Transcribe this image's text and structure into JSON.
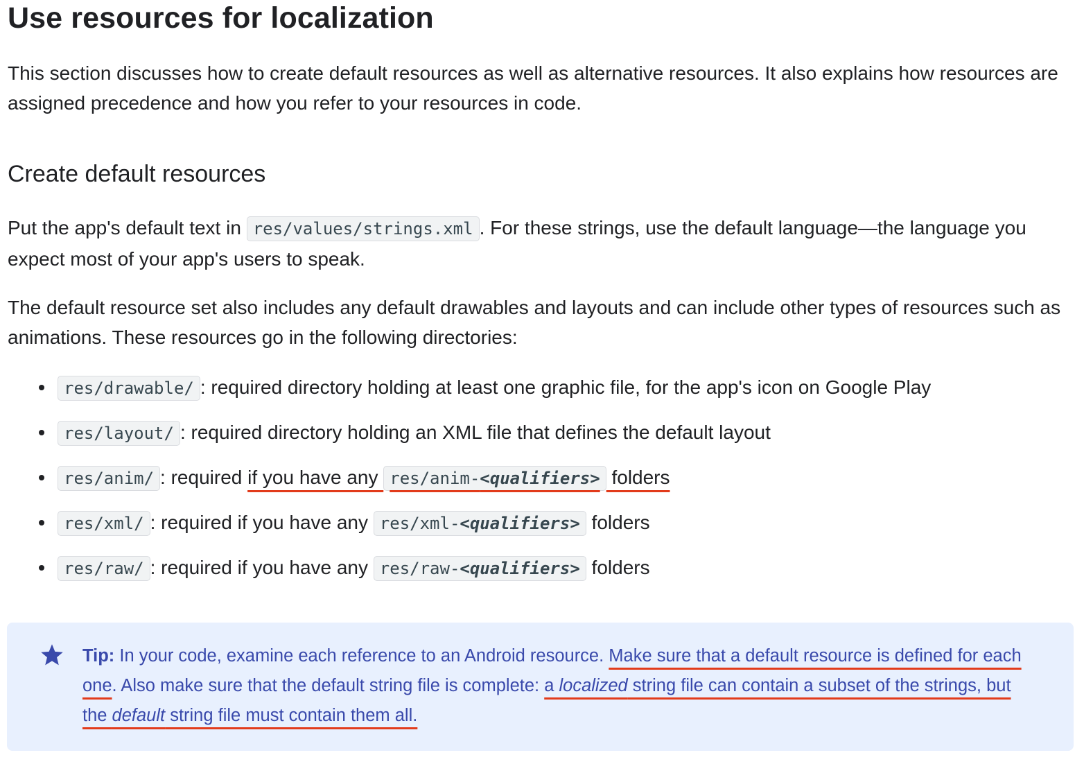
{
  "title": "Use resources for localization",
  "intro": "This section discusses how to create default resources as well as alternative resources. It also explains how resources are assigned precedence and how you refer to your resources in code.",
  "section_title": "Create default resources",
  "p2": {
    "before": "Put the app's default text in ",
    "code": "res/values/strings.xml",
    "after": ". For these strings, use the default language—the language you expect most of your app's users to speak."
  },
  "p3": "The default resource set also includes any default drawables and layouts and can include other types of resources such as animations. These resources go in the following directories:",
  "dirs": [
    {
      "code": "res/drawable/",
      "text": ": required directory holding at least one graphic file, for the app's icon on Google Play"
    },
    {
      "code": "res/layout/",
      "text": ": required directory holding an XML file that defines the default layout"
    },
    {
      "code": "res/anim/",
      "pre": ": required ",
      "u1": "if you have any ",
      "code2_prefix": "res/anim-",
      "code2_q": "<qualifiers>",
      "u2": " folders"
    },
    {
      "code": "res/xml/",
      "pre": ": required if you have any ",
      "code2_prefix": "res/xml-",
      "code2_q": "<qualifiers>",
      "post": " folders"
    },
    {
      "code": "res/raw/",
      "pre": ": required if you have any ",
      "code2_prefix": "res/raw-",
      "code2_q": "<qualifiers>",
      "post": " folders"
    }
  ],
  "tip": {
    "label": "Tip:",
    "t1": " In your code, examine each reference to an Android resource. ",
    "u1": "Make sure that a default resource is defined for each one",
    "t2": ". Also make sure that the default string file is complete: ",
    "u2a": "a ",
    "u2b": "localized",
    "u2c": " string file can contain a subset of the strings, but the ",
    "u2d": "default",
    "u2e": " string file must contain them all.",
    "icon": "star-icon",
    "color": "#3949ab",
    "background": "#e8f0fe"
  },
  "highlight_color": "#e23b1b"
}
